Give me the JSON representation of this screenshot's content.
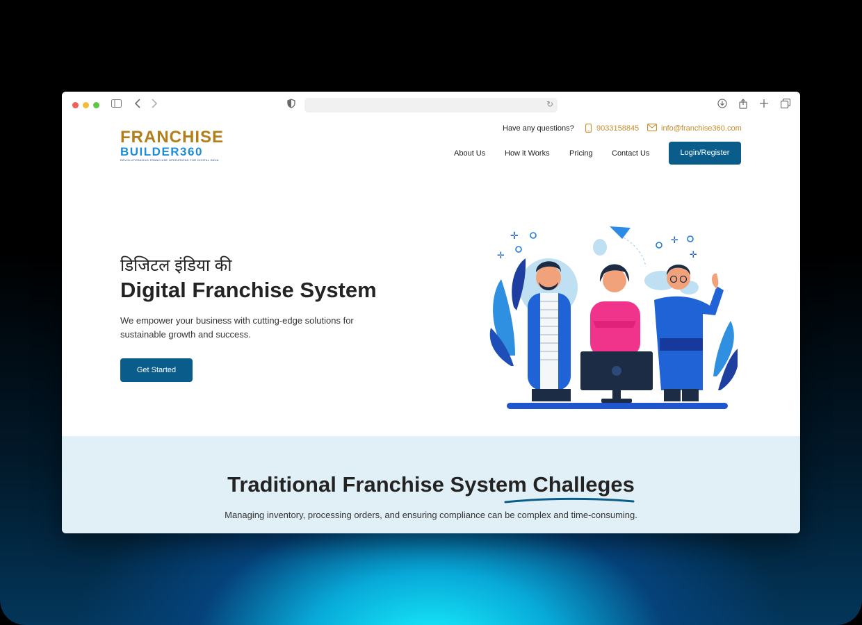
{
  "browser": {
    "icons": [
      "sidebar-icon",
      "back-icon",
      "forward-icon",
      "shield-icon",
      "reload-icon",
      "download-icon",
      "share-icon",
      "new-tab-icon",
      "tabs-overview-icon"
    ]
  },
  "logo": {
    "line1": "FRANCHISE",
    "line2": "BUILDER360",
    "tagline": "REVOLUTIONIZING FRANCHISE OPERATIONS FOR DIGITAL INDIA"
  },
  "contact": {
    "question": "Have any questions?",
    "phone": "9033158845",
    "email": "info@franchise360.com"
  },
  "nav": {
    "items": [
      {
        "label": "About Us"
      },
      {
        "label": "How it Works"
      },
      {
        "label": "Pricing"
      },
      {
        "label": "Contact Us"
      }
    ],
    "login_label": "Login/Register"
  },
  "hero": {
    "hindi_title": "डिजिटल इंडिया की",
    "title": "Digital Franchise System",
    "subtitle": "We empower your business with cutting-edge solutions for sustainable growth and success.",
    "cta_label": "Get Started"
  },
  "section2": {
    "title": "Traditional Franchise System Challeges",
    "subtitle": "Managing inventory, processing orders, and ensuring compliance can be complex and time-consuming."
  },
  "colors": {
    "brand_blue": "#0a5c8a",
    "logo_gold": "#b37d17",
    "logo_blue": "#1d8cd6",
    "accent_orange": "#c98d2c",
    "section_bg": "#e1f0f7"
  }
}
